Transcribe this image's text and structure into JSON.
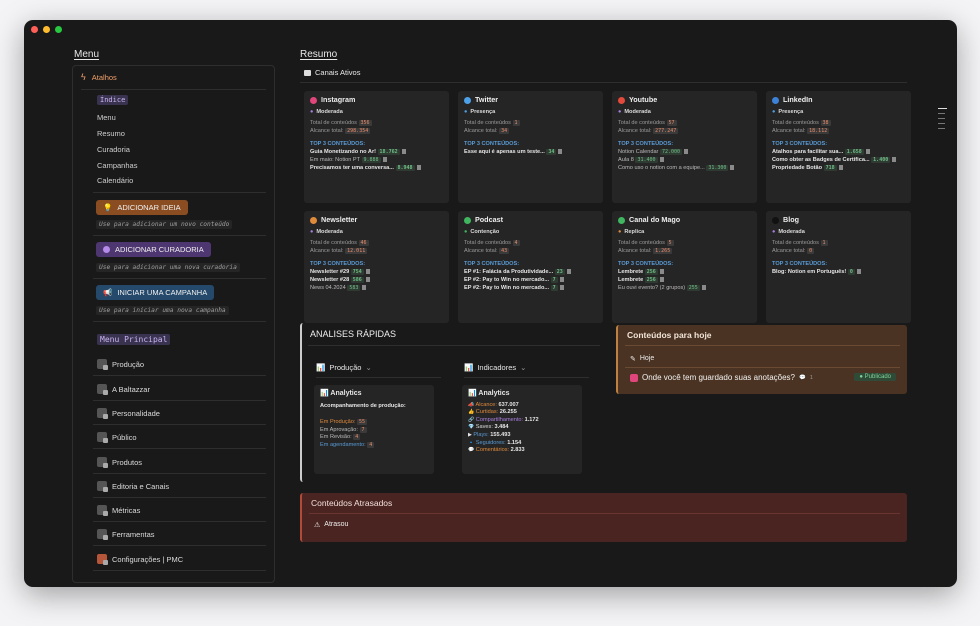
{
  "window": {
    "traffic_lights": [
      "#ff5f57",
      "#febc2e",
      "#28c840"
    ]
  },
  "menu": {
    "title": "Menu",
    "atalhos": "Atalhos",
    "links": [
      "Índice",
      "Menu",
      "Resumo",
      "Curadoria",
      "Campanhas",
      "Calendário"
    ],
    "btn_ideia": "ADICIONAR IDEIA",
    "hint_ideia": "Use para adicionar um novo conteúdo",
    "btn_curadoria": "ADICIONAR CURADORIA",
    "hint_curadoria": "Use para adicionar uma nova curadoria",
    "btn_campanha": "INICIAR UMA CAMPANHA",
    "hint_campanha": "Use para iniciar uma nova campanha",
    "menu_principal": "Menu Principal",
    "items": [
      "Produção",
      "A Baltazzar",
      "Personalidade",
      "Público",
      "Produtos",
      "Editoria e Canais",
      "Métricas",
      "Ferramentas",
      "Configurações | PMC"
    ]
  },
  "resumo": {
    "title": "Resumo",
    "canais": "Canais Ativos"
  },
  "labels": {
    "total": "Total de conteúdos",
    "alcance": "Alcance total:",
    "top3": "TOP 3 CONTEÚDOS:"
  },
  "channels": [
    {
      "name": "Instagram",
      "color": "#e0457b",
      "status": "Moderada",
      "status_color": "#a97fe0",
      "total": "356",
      "alcance": "298.354",
      "top": [
        [
          "Guia Monetizando no Ar!",
          "18.762"
        ],
        [
          "Em maio: Notion PT",
          "9.888"
        ],
        [
          "Precisamos ter uma conversa...",
          "8.948"
        ]
      ]
    },
    {
      "name": "Twitter",
      "color": "#4da1e8",
      "status": "Presença",
      "status_color": "#4da1e8",
      "total": "1",
      "alcance": "34",
      "top": [
        [
          "Esse aqui é apenas um teste...",
          "34"
        ]
      ]
    },
    {
      "name": "Youtube",
      "color": "#e34a3b",
      "status": "Moderada",
      "status_color": "#a97fe0",
      "total": "57",
      "alcance": "277.247",
      "top": [
        [
          "Notion Calendar",
          "72.000"
        ],
        [
          "Aula 8",
          "31.400"
        ],
        [
          "Como uso o notion com a equipe...",
          "31.300"
        ]
      ]
    },
    {
      "name": "LinkedIn",
      "color": "#3d82d6",
      "status": "Presença",
      "status_color": "#4da1e8",
      "total": "38",
      "alcance": "18.112",
      "top": [
        [
          "Atalhos para facilitar sua...",
          "1.658"
        ],
        [
          "Como obter as Badges de Certifica...",
          "1.400"
        ],
        [
          "Propriedade Botão",
          "718"
        ]
      ]
    },
    {
      "name": "Newsletter",
      "color": "#e08a3b",
      "status": "Moderada",
      "status_color": "#a97fe0",
      "total": "46",
      "alcance": "12.011",
      "top": [
        [
          "Newsletter #29",
          "754"
        ],
        [
          "Newsletter #28",
          "586"
        ],
        [
          "News 04.2024",
          "583"
        ]
      ]
    },
    {
      "name": "Podcast",
      "color": "#3fb65f",
      "status": "Contenção",
      "status_color": "#3fb65f",
      "total": "4",
      "alcance": "43",
      "top": [
        [
          "EP #1: Falácia da Produtividade...",
          "23"
        ],
        [
          "EP #2: Pay to Win no mercado...",
          "7"
        ],
        [
          "EP #2: Pay to Win no mercado...",
          "7"
        ]
      ]
    },
    {
      "name": "Canal do Mago",
      "color": "#3fb65f",
      "status": "Replica",
      "status_color": "#e08a3b",
      "total": "5",
      "alcance": "1.265",
      "top": [
        [
          "Lembrete",
          "256"
        ],
        [
          "Lembrete",
          "256"
        ],
        [
          "Eu ouvi evento? (2 grupos)",
          "255"
        ]
      ]
    },
    {
      "name": "Blog",
      "color": "#111111",
      "status": "Moderada",
      "status_color": "#a97fe0",
      "total": "1",
      "alcance": "0",
      "top": [
        [
          "Blog: Notion em Português!",
          "0"
        ]
      ]
    }
  ],
  "analises": {
    "title": "ANALISES RÁPIDAS",
    "tab1": "Produção",
    "tab2": "Indicadores",
    "card1": {
      "title": "Analytics",
      "subtitle": "Acompanhamento de produção:",
      "rows": [
        [
          "Em Produção:",
          "55"
        ],
        [
          "Em Aprovação:",
          "7"
        ],
        [
          "Em Revisão:",
          "4"
        ],
        [
          "Em agendamento:",
          "4"
        ]
      ]
    },
    "card2": {
      "title": "Analytics",
      "rows": [
        [
          "Alcance:",
          "637.007"
        ],
        [
          "Curtidas:",
          "26.255"
        ],
        [
          "Compartilhamento:",
          "1.172"
        ],
        [
          "Saves:",
          "3.484"
        ],
        [
          "Plays:",
          "155.493"
        ],
        [
          "Seguidores:",
          "1.154"
        ],
        [
          "Comentários:",
          "2.833"
        ]
      ]
    }
  },
  "hoje": {
    "title": "Conteúdos para hoje",
    "sub": "Hoje",
    "item": "Onde você tem guardado suas anotações?",
    "comments": "1",
    "badge": "Publicado"
  },
  "atrasados": {
    "title": "Conteúdos Atrasados",
    "sub": "Atrasou"
  }
}
